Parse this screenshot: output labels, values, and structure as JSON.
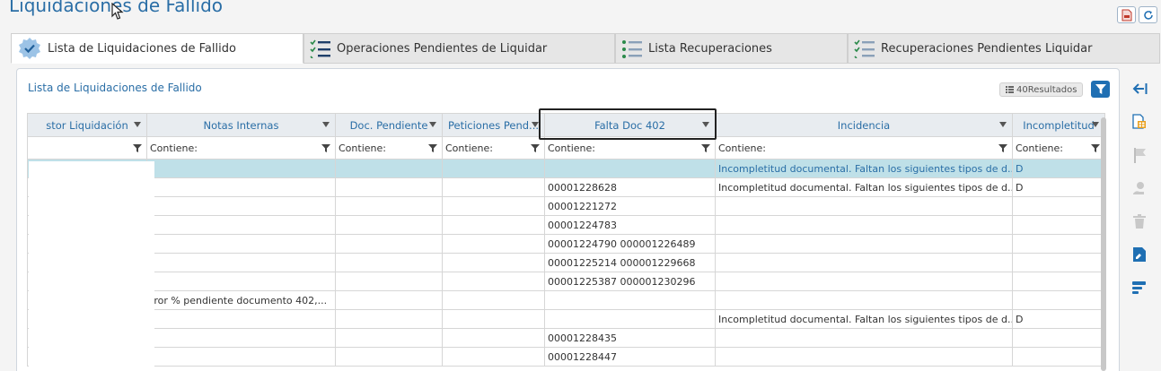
{
  "page": {
    "title": "Liquidaciones de Fallido"
  },
  "top_buttons": [
    {
      "icon": "pdf-export-icon"
    },
    {
      "icon": "refresh-icon"
    }
  ],
  "tabs": [
    {
      "label": "Lista de Liquidaciones de Fallido",
      "icon": "check-badge-icon",
      "active": true
    },
    {
      "label": "Operaciones Pendientes de Liquidar",
      "icon": "checklist-icon",
      "active": false
    },
    {
      "label": "Lista Recuperaciones",
      "icon": "list-icon",
      "active": false
    },
    {
      "label": "Recuperaciones Pendientes Liquidar",
      "icon": "checklist-icon",
      "active": false
    }
  ],
  "panel": {
    "title": "Lista de Liquidaciones de Fallido",
    "results": "40Resultados"
  },
  "grid": {
    "columns": [
      "stor Liquidación",
      "Notas Internas",
      "Doc. Pendiente",
      "Peticiones Pend...",
      "Falta Doc 402",
      "Incidencia",
      "Incompletitud"
    ],
    "filter_placeholder": "Contiene:",
    "rows": [
      [
        "",
        "",
        "",
        "",
        "",
        "Incompletitud documental. Faltan los siguientes tipos de d...",
        "D"
      ],
      [
        "",
        "",
        "",
        "",
        "00001228628",
        "Incompletitud documental. Faltan los siguientes tipos de d...",
        "D"
      ],
      [
        "",
        "",
        "",
        "",
        "00001221272",
        "",
        ""
      ],
      [
        "",
        "",
        "",
        "",
        "00001224783",
        "",
        ""
      ],
      [
        "",
        "",
        "",
        "",
        "00001224790  000001226489",
        "",
        ""
      ],
      [
        "",
        "",
        "",
        "",
        "00001225214  000001229668",
        "",
        ""
      ],
      [
        "",
        "",
        "",
        "",
        "00001225387  000001230296",
        "",
        ""
      ],
      [
        "",
        "rror % pendiente documento 402,...",
        "",
        "",
        "",
        "",
        ""
      ],
      [
        "",
        "",
        "",
        "",
        "",
        "Incompletitud documental. Faltan los siguientes tipos de d...",
        "D"
      ],
      [
        "",
        "",
        "",
        "",
        "00001228435",
        "",
        ""
      ],
      [
        "",
        "",
        "",
        "",
        "00001228447",
        "",
        ""
      ]
    ]
  },
  "side_tools": [
    "collapse-left-icon",
    "excel-export-icon",
    "flag-icon",
    "user-money-icon",
    "trash-icon",
    "document-edit-icon",
    "gantt-bars-icon"
  ],
  "colors": {
    "accent": "#1f6fb3",
    "title": "#2a6ea6",
    "selected_row": "#bfe0e8"
  }
}
